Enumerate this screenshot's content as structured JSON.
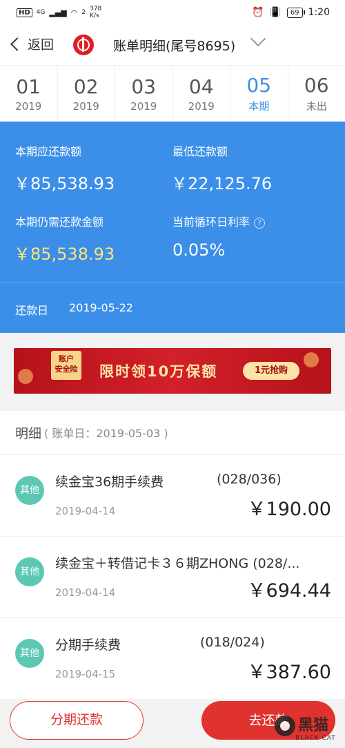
{
  "status_bar": {
    "hd": "HD",
    "network": "4G",
    "signal": "2",
    "speed_value": "378",
    "speed_unit": "K/s",
    "battery": "69",
    "time": "1:20"
  },
  "nav": {
    "back_label": "返回",
    "title": "账单明细(尾号8695)"
  },
  "periods": [
    {
      "month": "01",
      "year": "2019",
      "active": false
    },
    {
      "month": "02",
      "year": "2019",
      "active": false
    },
    {
      "month": "03",
      "year": "2019",
      "active": false
    },
    {
      "month": "04",
      "year": "2019",
      "active": false
    },
    {
      "month": "05",
      "year": "本期",
      "active": true
    },
    {
      "month": "06",
      "year": "未出",
      "active": false
    }
  ],
  "summary": {
    "due_label": "本期应还款额",
    "due_value": "￥85,538.93",
    "min_label": "最低还款额",
    "min_value": "￥22,125.76",
    "remaining_label": "本期仍需还款金额",
    "remaining_value": "￥85,538.93",
    "rate_label": "当前循环日利率",
    "rate_value": "0.05%",
    "due_date_label": "还款日",
    "due_date_value": "2019-05-22"
  },
  "banner": {
    "tag_line1": "账户",
    "tag_line2": "安全险",
    "text": "限时领10万保额",
    "button": "1元抢购"
  },
  "detail": {
    "title": "明细",
    "subtitle": "( 账单日：2019-05-03 )"
  },
  "transactions": [
    {
      "badge": "其他",
      "name": "续金宝36期手续费",
      "seq": "(028/036)",
      "date": "2019-04-14",
      "amount": "￥190.00"
    },
    {
      "badge": "其他",
      "name": "续金宝＋转借记卡３６期ZHONG (028/...",
      "seq": "",
      "date": "2019-04-14",
      "amount": "￥694.44"
    },
    {
      "badge": "其他",
      "name": "分期手续费",
      "seq": "(018/024)",
      "date": "2019-04-15",
      "amount": "￥387.60"
    }
  ],
  "bottom": {
    "installment_label": "分期还款",
    "pay_label": "去还款"
  },
  "watermark": {
    "text": "黑猫",
    "sub": "BLACK CAT"
  },
  "colors": {
    "accent_blue": "#3b8fe8",
    "highlight_yellow": "#ffe27a",
    "brand_red": "#e0322e",
    "badge_teal": "#5bc8b4"
  }
}
